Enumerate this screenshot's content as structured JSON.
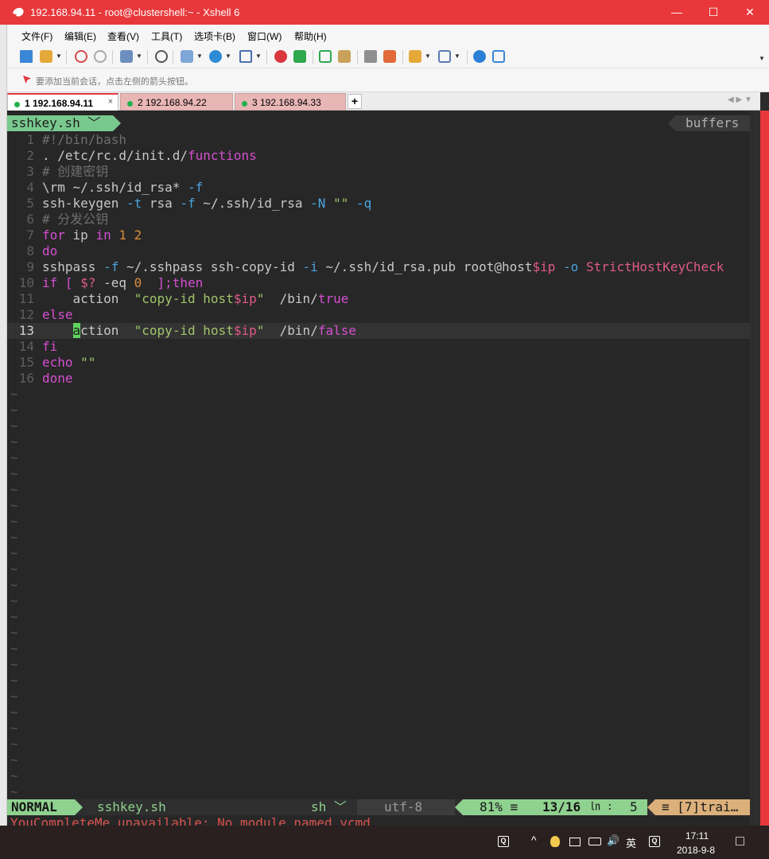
{
  "window": {
    "title": "192.168.94.11 - root@clustershell:~ - Xshell 6",
    "minimize": "—",
    "maximize": "☐",
    "close": "✕"
  },
  "menu": [
    "文件(F)",
    "编辑(E)",
    "查看(V)",
    "工具(T)",
    "选项卡(B)",
    "窗口(W)",
    "帮助(H)"
  ],
  "hint": "要添加当前会话，点击左侧的箭头按钮。",
  "tabs": [
    {
      "label": "1 192.168.94.11",
      "close": "×"
    },
    {
      "label": "2 192.168.94.22"
    },
    {
      "label": "3 192.168.94.33"
    }
  ],
  "tab_add": "+",
  "tab_nav": "◀ ▶ ▼",
  "vim": {
    "buffer_tab": "sshkey.sh ﹀",
    "buffers_label": "buffers",
    "lines": [
      {
        "n": "1",
        "tokens": [
          {
            "t": "#!/bin/bash",
            "c": "com"
          }
        ]
      },
      {
        "n": "2",
        "tokens": [
          {
            "t": ". /etc/rc.d/init.d/",
            "c": "pl"
          },
          {
            "t": "functions",
            "c": "fn"
          }
        ]
      },
      {
        "n": "3",
        "tokens": [
          {
            "t": "# 创建密钥",
            "c": "com"
          }
        ]
      },
      {
        "n": "4",
        "tokens": [
          {
            "t": "\\rm ~/.ssh/id_rsa* ",
            "c": "pl"
          },
          {
            "t": "-f",
            "c": "flag"
          }
        ]
      },
      {
        "n": "5",
        "tokens": [
          {
            "t": "ssh-keygen ",
            "c": "pl"
          },
          {
            "t": "-t",
            "c": "flag"
          },
          {
            "t": " rsa ",
            "c": "pl"
          },
          {
            "t": "-f",
            "c": "flag"
          },
          {
            "t": " ~/.ssh/id_rsa ",
            "c": "pl"
          },
          {
            "t": "-N",
            "c": "flag"
          },
          {
            "t": " \"\" ",
            "c": "str"
          },
          {
            "t": "-q",
            "c": "flag"
          }
        ]
      },
      {
        "n": "6",
        "tokens": [
          {
            "t": "# 分发公钥",
            "c": "com"
          }
        ]
      },
      {
        "n": "7",
        "tokens": [
          {
            "t": "for",
            "c": "kw"
          },
          {
            "t": " ip ",
            "c": "pl"
          },
          {
            "t": "in",
            "c": "kw"
          },
          {
            "t": " ",
            "c": "pl"
          },
          {
            "t": "1 2",
            "c": "num"
          }
        ]
      },
      {
        "n": "8",
        "tokens": [
          {
            "t": "do",
            "c": "kw"
          }
        ]
      },
      {
        "n": "9",
        "tokens": [
          {
            "t": "sshpass ",
            "c": "pl"
          },
          {
            "t": "-f",
            "c": "flag"
          },
          {
            "t": " ~/.sshpass ssh-copy-id ",
            "c": "pl"
          },
          {
            "t": "-i",
            "c": "flag"
          },
          {
            "t": " ~/.ssh/id_rsa.pub root@host",
            "c": "pl"
          },
          {
            "t": "$ip",
            "c": "var"
          },
          {
            "t": " ",
            "c": "pl"
          },
          {
            "t": "-o",
            "c": "flag"
          },
          {
            "t": " StrictHostKeyCheck",
            "c": "var"
          }
        ]
      },
      {
        "n": "10",
        "tokens": [
          {
            "t": "if",
            "c": "kw"
          },
          {
            "t": " [ ",
            "c": "fn"
          },
          {
            "t": "$?",
            "c": "var"
          },
          {
            "t": " -eq ",
            "c": "pl"
          },
          {
            "t": "0",
            "c": "num"
          },
          {
            "t": "  ];then",
            "c": "kw"
          }
        ]
      },
      {
        "n": "11",
        "tokens": [
          {
            "t": "    action  ",
            "c": "pl"
          },
          {
            "t": "\"copy-id host",
            "c": "str"
          },
          {
            "t": "$ip",
            "c": "var"
          },
          {
            "t": "\"",
            "c": "str"
          },
          {
            "t": "  /bin/",
            "c": "pl"
          },
          {
            "t": "true",
            "c": "kw"
          }
        ]
      },
      {
        "n": "12",
        "tokens": [
          {
            "t": "else",
            "c": "kw"
          }
        ]
      },
      {
        "n": "13",
        "current": true,
        "tokens": [
          {
            "t": "    ",
            "c": "pl"
          },
          {
            "t": "a",
            "c": "cursor"
          },
          {
            "t": "ction  ",
            "c": "pl"
          },
          {
            "t": "\"copy-id host",
            "c": "str"
          },
          {
            "t": "$ip",
            "c": "var"
          },
          {
            "t": "\"",
            "c": "str"
          },
          {
            "t": "  /bin/",
            "c": "pl"
          },
          {
            "t": "false",
            "c": "kw"
          }
        ]
      },
      {
        "n": "14",
        "tokens": [
          {
            "t": "fi",
            "c": "kw"
          }
        ]
      },
      {
        "n": "15",
        "tokens": [
          {
            "t": "echo ",
            "c": "kw"
          },
          {
            "t": "\"\"",
            "c": "str"
          }
        ]
      },
      {
        "n": "16",
        "tokens": [
          {
            "t": "done",
            "c": "kw"
          }
        ]
      }
    ],
    "tilde": "~",
    "tilde_count": 26,
    "status": {
      "mode": "NORMAL",
      "file": "sshkey.sh",
      "filetype": "sh ﹀",
      "encoding": "utf-8",
      "percent": "81% ≡",
      "position": "13/16",
      "ln_symbol": "㏑ :",
      "column": "5",
      "trailing": "≡ [7]trai…"
    },
    "cmdline": "YouCompleteMe unavailable: No module named ycmd"
  },
  "taskbar": {
    "qq1": "Q",
    "chevron": "^",
    "speaker": "🔊",
    "ime": "英",
    "qq2": "Q",
    "time": "17:11",
    "date": "2018-9-8",
    "notify": "□"
  }
}
